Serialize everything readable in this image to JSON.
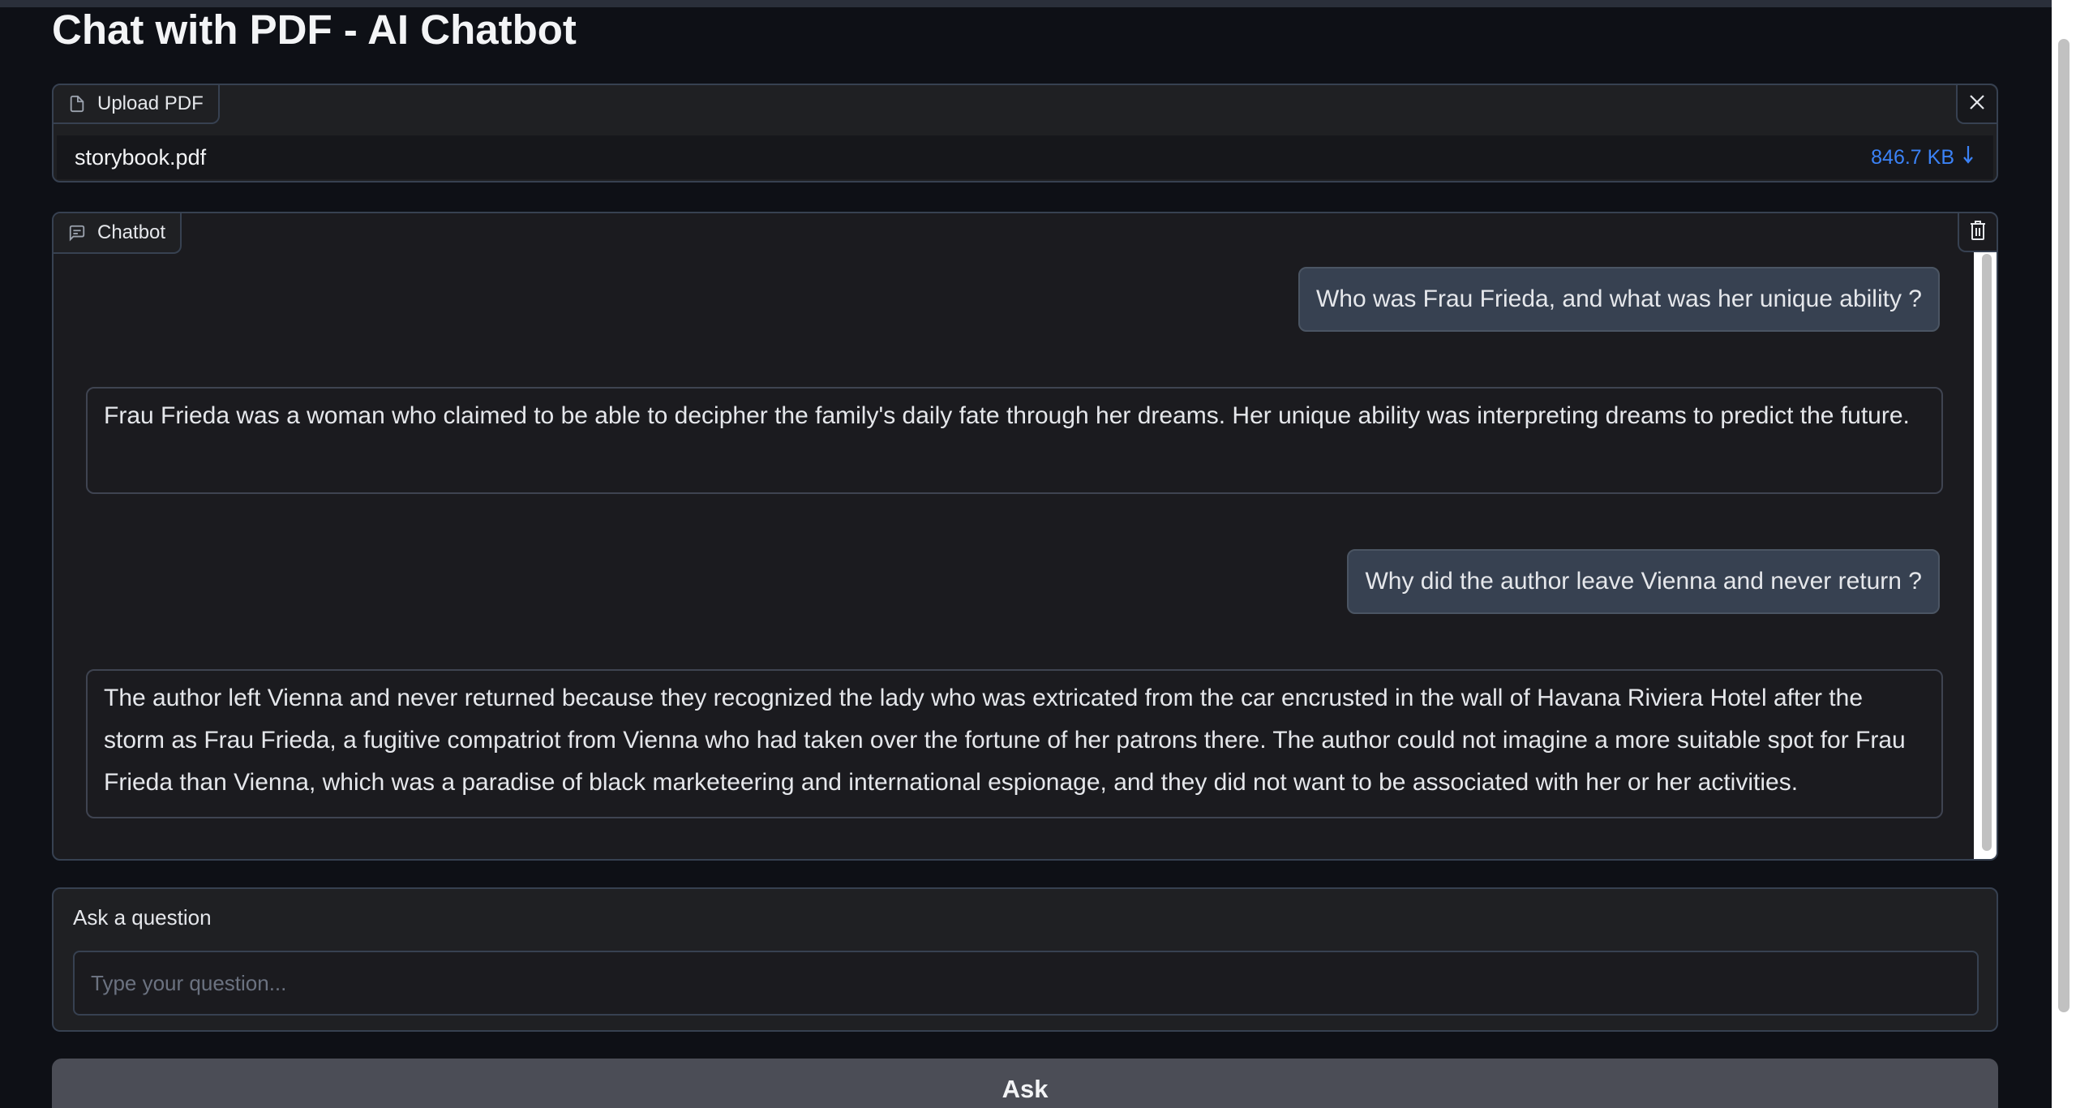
{
  "app": {
    "title": "Chat with PDF - AI Chatbot"
  },
  "upload": {
    "label": "Upload PDF",
    "file_name": "storybook.pdf",
    "file_size": "846.7 KB"
  },
  "chatbot": {
    "label": "Chatbot",
    "messages": [
      {
        "role": "user",
        "text": "Who was Frau Frieda, and what was her unique ability ?"
      },
      {
        "role": "bot",
        "text": "Frau Frieda was a woman who claimed to be able to decipher the family's daily fate through her dreams. Her unique ability was interpreting dreams to predict the future."
      },
      {
        "role": "user",
        "text": "Why did the author leave Vienna and never return ?"
      },
      {
        "role": "bot",
        "text": "The author left Vienna and never returned because they recognized the lady who was extricated from the car encrusted in the wall of Havana Riviera Hotel after the storm as Frau Frieda, a fugitive compatriot from Vienna who had taken over the fortune of her patrons there. The author could not imagine a more suitable spot for Frau Frieda than Vienna, which was a paradise of black marketeering and international espionage, and they did not want to be associated with her or her activities."
      }
    ]
  },
  "question": {
    "label": "Ask a question",
    "placeholder": "Type your question..."
  },
  "ask_button": {
    "label": "Ask"
  },
  "colors": {
    "accent": "#3b82f6",
    "background": "#0e1016",
    "panel": "#1f2023",
    "border": "#374151"
  }
}
